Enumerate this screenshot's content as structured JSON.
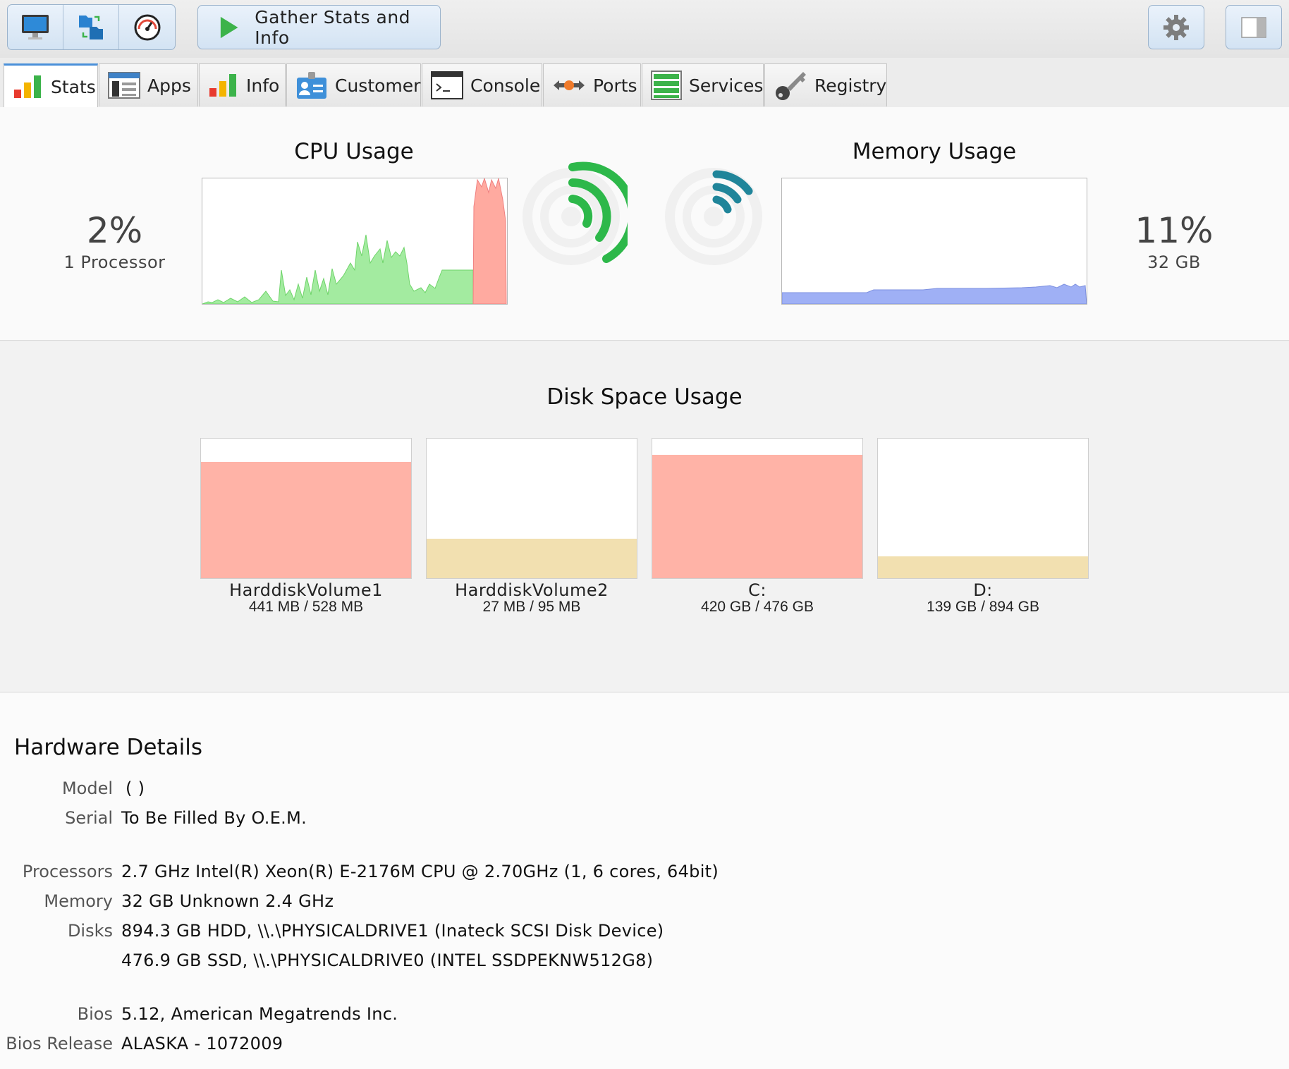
{
  "toolbar": {
    "left_icons": [
      "monitor-icon",
      "file-transfer-icon",
      "speedometer-icon"
    ],
    "gather_label": "Gather Stats and Info"
  },
  "tabs": [
    {
      "label": "Stats",
      "icon": "bar-chart-icon",
      "active": true
    },
    {
      "label": "Apps",
      "icon": "apps-window-icon"
    },
    {
      "label": "Info",
      "icon": "bar-chart-icon"
    },
    {
      "label": "Customer",
      "icon": "customer-card-icon"
    },
    {
      "label": "Console",
      "icon": "terminal-icon"
    },
    {
      "label": "Ports",
      "icon": "ports-arrows-icon"
    },
    {
      "label": "Services",
      "icon": "services-list-icon"
    },
    {
      "label": "Registry",
      "icon": "key-icon"
    }
  ],
  "cpu": {
    "title": "CPU Usage",
    "percent": "2%",
    "detail": "1 Processor"
  },
  "memory": {
    "title": "Memory Usage",
    "percent": "11%",
    "detail": "32 GB"
  },
  "disk_section": {
    "title": "Disk Space Usage"
  },
  "disks": [
    {
      "name": "HarddiskVolume1",
      "size": "441 MB / 528 MB",
      "used_fraction": 0.835,
      "color": "#ffb3a7"
    },
    {
      "name": "HarddiskVolume2",
      "size": "27 MB / 95 MB",
      "used_fraction": 0.284,
      "color": "#f2e0b0"
    },
    {
      "name": "C:",
      "size": "420 GB / 476 GB",
      "used_fraction": 0.882,
      "color": "#ffb3a7"
    },
    {
      "name": "D:",
      "size": "139 GB / 894 GB",
      "used_fraction": 0.155,
      "color": "#f2e0b0"
    }
  ],
  "hardware": {
    "title": "Hardware Details",
    "model_label": "Model",
    "model_value": "( )",
    "serial_label": "Serial",
    "serial_value": "To Be Filled By O.E.M.",
    "processors_label": "Processors",
    "processors_value": "2.7 GHz Intel(R) Xeon(R) E-2176M  CPU @ 2.70GHz (1, 6 cores, 64bit)",
    "memory_label": "Memory",
    "memory_value": "32 GB Unknown 2.4 GHz",
    "disks_label": "Disks",
    "disks_value_1": "894.3 GB HDD, \\\\.\\PHYSICALDRIVE1 (Inateck  SCSI Disk Device)",
    "disks_value_2": "476.9 GB SSD, \\\\.\\PHYSICALDRIVE0 (INTEL SSDPEKNW512G8)",
    "bios_label": "Bios",
    "bios_value": "5.12, American Megatrends Inc.",
    "bios_release_label": "Bios Release",
    "bios_release_value": "ALASKA - 1072009"
  },
  "colors": {
    "cpu_fill": "#a3eba0",
    "cpu_spike": "#ffaaa0",
    "memory_fill": "#9fb0f5",
    "signal_green": "#2db84a",
    "signal_teal": "#20859a"
  }
}
